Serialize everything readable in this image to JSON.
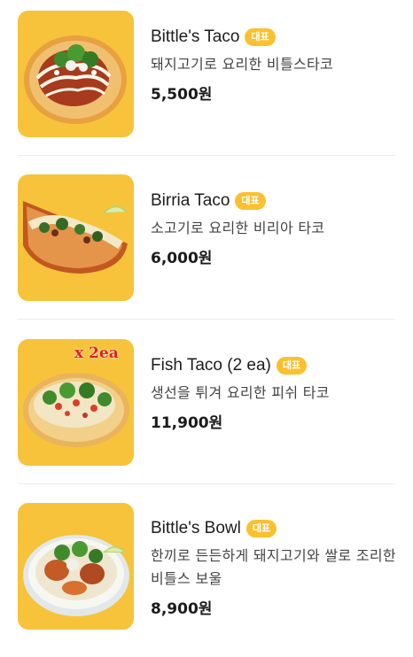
{
  "badge_label": "대표",
  "menu_items": [
    {
      "name": "Bittle's Taco",
      "description": "돼지고기로 요리한 비틀스타코",
      "price": "5,500원",
      "image_icon": "pork-taco-photo"
    },
    {
      "name": "Birria Taco",
      "description": "소고기로 요리한 비리아 타코",
      "price": "6,000원",
      "image_icon": "birria-taco-photo"
    },
    {
      "name": "Fish Taco (2 ea)",
      "description": "생선을 튀겨 요리한 피쉬 타코",
      "price": "11,900원",
      "image_icon": "fish-taco-photo",
      "image_overlay_text": "x 2ea"
    },
    {
      "name": "Bittle's Bowl",
      "description": "한끼로 든든하게 돼지고기와 쌀로 조리한 비틀스 보울",
      "price": "8,900원",
      "image_icon": "rice-bowl-photo"
    }
  ],
  "colors": {
    "thumb_background": "#f6c33b",
    "badge_background": "#fbc02d",
    "overlay_text": "#e0201c"
  }
}
